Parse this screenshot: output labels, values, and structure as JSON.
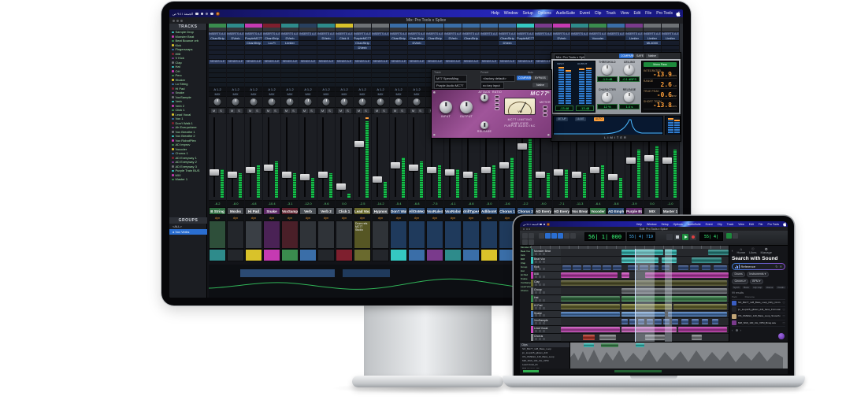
{
  "menu": {
    "items": [
      "Help",
      "Window",
      "Setup",
      "Options",
      "AudioSuite",
      "Event",
      "Clip",
      "Track",
      "View",
      "Edit",
      "File",
      "Pro Tools"
    ],
    "status_time": "الجمعة ٩:٤١ ص"
  },
  "monitor": {
    "window_title": "Mix: Pro Tools x Splice",
    "tracks_panel": {
      "title": "TRACKS",
      "dot_colors": [
        "#35c8c2",
        "#c53ab2",
        "#3a8c4e",
        "#d9c22a",
        "#3a6ea8",
        "#7e1f2e",
        "#7a3a8c",
        "#6e7276"
      ],
      "items": [
        "Sample Drop",
        "Monster Beat",
        "Beat Bounce vrb",
        "Kick",
        "Fingersnaps",
        "808",
        "V Kick",
        "Clap",
        "Hat",
        "OH",
        "Perc",
        "Shaker",
        "Lo String",
        "Hi Pad",
        "Snake",
        "VoxSample",
        "Verb",
        "Verb 2",
        "Click 1",
        "Lead Vocal",
        "Vox 1",
        "Don't Walk 1",
        "Ah Everywhere",
        "Vox Breathe 1",
        "Vox Breathe 2",
        "Vox RobotPlex",
        "AD Improv",
        "Vocoder",
        "Chorus 1",
        "AD Everyway 1",
        "AD Everyway 2",
        "AD Everyway 3",
        "Purple Train BUS",
        "MIX",
        "Master 1"
      ]
    },
    "groups_panel": {
      "title": "GROUPS",
      "items": [
        "<ALL>",
        "a Vox Verbs"
      ]
    },
    "mixer": {
      "inserts_label": "INSERTS A-E",
      "sends_label": "SENDS A-E",
      "io_in": "A 1-2",
      "io_out": "MIX",
      "auto_mode": "dyn",
      "color_band": [
        "#2e8b8b",
        "#23262b",
        "#d9c22a",
        "#c53ab2",
        "#3a8c4e",
        "#3a6ea8",
        "#23262b",
        "#7e1f2e",
        "#6a6a2e",
        "#23262b",
        "#35c8c2",
        "#3a6ea8",
        "#7a3a8c",
        "#2e8b8b",
        "#3a6ea8",
        "#d9c22a",
        "#3a6ea8",
        "#35c8c2",
        "#7a3a8c",
        "#c53ab2",
        "#3a8c4e",
        "#2e8b8b",
        "#3a6ea8",
        "#7a3a8c",
        "#44484e",
        "#44484e"
      ],
      "strips": [
        {
          "name": "B String",
          "cap": "#3a8c4e",
          "plate": "#2e6b40",
          "cmt": "#2e4f3a",
          "lvl": 0.35,
          "vol": "-6.2",
          "ins": [
            "ChanStrip"
          ]
        },
        {
          "name": "Mocks",
          "cap": "#2e8b8b",
          "plate": "#44484e",
          "cmt": "#23262b",
          "lvl": 0.3,
          "vol": "-8.0",
          "ins": [
            "DVerb"
          ]
        },
        {
          "name": "Hi Pad",
          "cap": "#c53ab2",
          "plate": "#5a5e64",
          "cmt": "#3a3f45",
          "lvl": 0.4,
          "vol": "-4.8",
          "ins": [
            "PurpleMC77",
            "ChanStrip"
          ]
        },
        {
          "name": "Snake",
          "cap": "#7e1f2e",
          "plate": "#5d2a66",
          "cmt": "#4a2255",
          "lvl": 0.45,
          "vol": "-10.4",
          "ins": [
            "ChanStrip",
            "Lo-Fi"
          ]
        },
        {
          "name": "VoxSample",
          "cap": "#2e8b8b",
          "plate": "#5d2430",
          "cmt": "#4a1f28",
          "lvl": 0.3,
          "vol": "-3.1",
          "ins": [
            "DVerb",
            "Limiter"
          ]
        },
        {
          "name": "Verb",
          "cap": "#28405e",
          "plate": "#4a4f55",
          "cmt": "#2f3338",
          "lvl": 0.25,
          "vol": "-12.0",
          "ins": []
        },
        {
          "name": "Verb 2",
          "cap": "#2e8b8b",
          "plate": "#4a4f55",
          "cmt": "#2f3338",
          "lvl": 0.3,
          "vol": "-9.6",
          "ins": [
            "DVerb"
          ]
        },
        {
          "name": "Click 1",
          "cap": "#d9c22a",
          "plate": "#4a4f55",
          "cmt": "#2f3338",
          "lvl": 0.05,
          "vol": "0.0",
          "ins": [
            "Click II"
          ]
        },
        {
          "name": "Lead Vocal",
          "cap": "#6e7276",
          "plate": "#6a6a2e",
          "cmt": "#565624",
          "lvl": 0.95,
          "vol": "-2.5",
          "ins": [
            "PurpleMC77",
            "ChanStrip",
            "DVerb"
          ],
          "note": "Drum refs MC77 Studio"
        },
        {
          "name": "Hypnos",
          "cap": "#6e7276",
          "plate": "#4a4f55",
          "cmt": "#2f3338",
          "lvl": 0.2,
          "vol": "-14.2",
          "ins": []
        },
        {
          "name": "Don't Walk!",
          "cap": "#3a6ea8",
          "plate": "#2b4a73",
          "cmt": "#1f3a5c",
          "lvl": 0.5,
          "vol": "-5.4",
          "ins": [
            "ChanStrip"
          ]
        },
        {
          "name": "AllOnMe2",
          "cap": "#3a6ea8",
          "plate": "#2b4a73",
          "cmt": "#1f3a5c",
          "lvl": 0.45,
          "vol": "-6.8",
          "ins": [
            "ChanStrip",
            "DVerb"
          ]
        },
        {
          "name": "VoxRule4",
          "cap": "#3a6ea8",
          "plate": "#2b4a73",
          "cmt": "#1f3a5c",
          "lvl": 0.4,
          "vol": "-7.5",
          "ins": [
            "ChanStrip"
          ]
        },
        {
          "name": "VoxRobot2",
          "cap": "#3a6ea8",
          "plate": "#2b4a73",
          "cmt": "#1f3a5c",
          "lvl": 0.35,
          "vol": "-4.1",
          "ins": [
            "DVerb"
          ]
        },
        {
          "name": "drillTypeAly",
          "cap": "#3a6ea8",
          "plate": "#2b4a73",
          "cmt": "#1f3a5c",
          "lvl": 0.3,
          "vol": "-8.8",
          "ins": [
            "ChanStrip"
          ]
        },
        {
          "name": "AdlibsnKme",
          "cap": "#3a6ea8",
          "plate": "#2b4a73",
          "cmt": "#1f3a5c",
          "lvl": 0.4,
          "vol": "-5.0",
          "ins": []
        },
        {
          "name": "Chorus 1",
          "cap": "#3a6ea8",
          "plate": "#2b4a73",
          "cmt": "#1f3a5c",
          "lvl": 0.5,
          "vol": "-3.6",
          "ins": [
            "ChanStrip",
            "DVerb"
          ]
        },
        {
          "name": "Chorus 2",
          "cap": "#35c8c2",
          "plate": "#2b4a73",
          "cmt": "#1f3a5c",
          "lvl": 0.9,
          "vol": "-2.2",
          "ins": [
            "PurpleMC77"
          ]
        },
        {
          "name": "AD Every 1",
          "cap": "#7a3a8c",
          "plate": "#4a4f55",
          "cmt": "#3a2a45",
          "lvl": 0.3,
          "vol": "-9.0",
          "ins": []
        },
        {
          "name": "AD Every 2",
          "cap": "#c53ab2",
          "plate": "#4a4f55",
          "cmt": "#3a2a45",
          "lvl": 0.35,
          "vol": "-7.1",
          "ins": [
            "DVerb"
          ]
        },
        {
          "name": "Vox Breathe",
          "cap": "#2e8b8b",
          "plate": "#44484e",
          "cmt": "#23262b",
          "lvl": 0.3,
          "vol": "-11.3",
          "ins": []
        },
        {
          "name": "Vocoder",
          "cap": "#3a8c4e",
          "plate": "#2e6b40",
          "cmt": "#2e4f3a",
          "lvl": 0.4,
          "vol": "-6.4",
          "ins": [
            "Vocoder"
          ]
        },
        {
          "name": "AD Emph 1",
          "cap": "#3a6ea8",
          "plate": "#2b4a73",
          "cmt": "#1f3a5c",
          "lvl": 0.25,
          "vol": "-5.8",
          "ins": []
        },
        {
          "name": "Purple BUS",
          "cap": "#7a3a8c",
          "plate": "#5d2a66",
          "cmt": "#4a2255",
          "lvl": 0.6,
          "vol": "-3.9",
          "ins": [
            "Limiter"
          ]
        },
        {
          "name": "MIX",
          "cap": "#6e7276",
          "plate": "#44484e",
          "cmt": "#2f3338",
          "lvl": 0.65,
          "vol": "0.0",
          "ins": [
            "Limiter",
            "ML4000"
          ]
        },
        {
          "name": "Master 1",
          "cap": "#6e7276",
          "plate": "#44484e",
          "cmt": "#2f3338",
          "lvl": 0.6,
          "vol": "-1.0",
          "ins": [
            "Limiter"
          ]
        }
      ]
    },
    "mc77": {
      "track_label": "Track",
      "preset_label": "Preset",
      "auto_label": "Auto",
      "track_name": "M77 SpecsMag",
      "plugin_name": "Purple Audio MC77",
      "preset_name": "<factory default>",
      "compare": "COMPARE",
      "bypass": "BYPASS",
      "native": "Native",
      "key_input": "no key input",
      "input_label": "INPUT",
      "output_label": "OUTPUT",
      "attack_label": "ATTACK",
      "release_label": "RELEASE",
      "ratio_label": "RATIO",
      "meter_label": "METER",
      "vu_label": "VU",
      "brand_line1": "MC77 LIMITING AMPLIFIER",
      "brand_line2": "PURPLE AUDIO INC",
      "logo": "MC77"
    },
    "limiter": {
      "title": "LIMITER",
      "compare": "COMPARE",
      "safe": "SAFE",
      "native": "Native",
      "preset": "Mono Pass",
      "brand": "weiss",
      "input_label": "INPUT",
      "output_label": "OUTPUT",
      "input_value": "-13.48",
      "output_value": "-13.48",
      "knobs": [
        {
          "label": "THRESHOLD",
          "value": "-1.5 dB"
        },
        {
          "label": "CEILING",
          "value": "-0.1 dBFS"
        },
        {
          "label": "CHARACTER",
          "value": "12 %"
        },
        {
          "label": "RELEASE",
          "value": "1.0 s"
        }
      ],
      "loudness": [
        {
          "label": "INTEGRATED",
          "value": "-13.9",
          "unit": "LUFS"
        },
        {
          "label": "RANGE",
          "value": "2.6",
          "unit": "LU"
        },
        {
          "label": "TRUE PEAK",
          "value": "-0.6",
          "unit": "dBTP"
        },
        {
          "label": "SHORT TERM",
          "value": "-13.8",
          "unit": "LUFS"
        }
      ],
      "graph_tabs": [
        "SETUP",
        "16-BIT",
        "AUTO"
      ]
    }
  },
  "laptop": {
    "window_title": "Edit: Pro Tools x Splice",
    "toolbar": {
      "main_counter": "56|  1|  000",
      "sub_counter": "55|  4|  719"
    },
    "rows": [
      {
        "name": "Monster Beat",
        "hdr": "#2e6e66",
        "clips": [
          [
            0.36,
            0.25,
            "#35c8c2"
          ],
          [
            0.62,
            0.07,
            "#35c8c2"
          ],
          [
            0.88,
            0.12,
            "#2a8f8a"
          ]
        ]
      },
      {
        "name": "Beat Vox",
        "hdr": "#35c8c2",
        "clips": [
          [
            0.36,
            0.22,
            "#49d8d2"
          ],
          [
            0.6,
            0.09,
            "#49d8d2"
          ],
          [
            0.78,
            0.18,
            "#2a8f8a"
          ]
        ]
      },
      {
        "name": "Kick",
        "hdr": "#3a5e9e",
        "clips": [
          [
            0.01,
            0.05,
            "#33508a"
          ],
          [
            0.07,
            0.05,
            "#33508a"
          ],
          [
            0.13,
            0.05,
            "#33508a"
          ],
          [
            0.19,
            0.05,
            "#33508a"
          ],
          [
            0.25,
            0.05,
            "#33508a"
          ],
          [
            0.31,
            0.05,
            "#33508a"
          ],
          [
            0.4,
            0.06,
            "#33508a"
          ],
          [
            0.47,
            0.05,
            "#33508a"
          ],
          [
            0.53,
            0.05,
            "#33508a"
          ],
          [
            0.6,
            0.05,
            "#33508a"
          ],
          [
            0.7,
            0.06,
            "#33508a"
          ],
          [
            0.77,
            0.05,
            "#33508a"
          ],
          [
            0.84,
            0.05,
            "#33508a"
          ],
          [
            0.91,
            0.08,
            "#33508a"
          ]
        ]
      },
      {
        "name": "808",
        "hdr": "#c53ab2",
        "clips": [
          [
            0.0,
            0.34,
            "#c53ab2"
          ],
          [
            0.36,
            0.05,
            "#e357d0"
          ],
          [
            0.5,
            0.5,
            "#c53ab2"
          ]
        ]
      },
      {
        "name": "Clap",
        "hdr": "#6a6a2e",
        "clips": [
          [
            0.0,
            0.99,
            "#56562a"
          ]
        ]
      },
      {
        "name": "Group",
        "hdr": "#6e7276",
        "clips": [
          [
            0.36,
            0.63,
            "#70747a"
          ]
        ]
      },
      {
        "name": "Hat",
        "hdr": "#3a8c4e",
        "clips": [
          [
            0.0,
            0.35,
            "#2f6b3e"
          ],
          [
            0.36,
            0.63,
            "#3f8c50"
          ]
        ]
      },
      {
        "name": "Hi Pad",
        "hdr": "#8a8a3a",
        "clips": [
          [
            0.0,
            0.35,
            "#6a6a2e"
          ],
          [
            0.36,
            0.3,
            "#8a8a3a"
          ],
          [
            0.67,
            0.32,
            "#6a6a2e"
          ]
        ]
      },
      {
        "name": "Snake",
        "hdr": "#4a7ec2",
        "clips": [
          [
            0.0,
            0.35,
            "#4a7ec2"
          ],
          [
            0.36,
            0.26,
            "#6aa0e0"
          ],
          [
            0.64,
            0.35,
            "#4a7ec2"
          ]
        ]
      },
      {
        "name": "VoxSample",
        "hdr": "#3a6ea8",
        "clips": [
          [
            0.36,
            0.04,
            "#4a6eb0"
          ],
          [
            0.41,
            0.04,
            "#4a6eb0"
          ],
          [
            0.46,
            0.04,
            "#4a6eb0"
          ],
          [
            0.51,
            0.04,
            "#4a6eb0"
          ],
          [
            0.56,
            0.04,
            "#4a6eb0"
          ],
          [
            0.61,
            0.04,
            "#4a6eb0"
          ],
          [
            0.66,
            0.04,
            "#4a6eb0"
          ],
          [
            0.72,
            0.04,
            "#4a6eb0"
          ],
          [
            0.78,
            0.04,
            "#4a6eb0"
          ],
          [
            0.84,
            0.04,
            "#4a6eb0"
          ],
          [
            0.9,
            0.04,
            "#4a6eb0"
          ]
        ]
      },
      {
        "name": "Lead Vocal",
        "hdr": "#d04ac0",
        "clips": [
          [
            0.0,
            0.35,
            "#d04ac0"
          ],
          [
            0.36,
            0.33,
            "#e06ad0"
          ],
          [
            0.7,
            0.29,
            "#c53ab2"
          ]
        ]
      },
      {
        "name": "Chorus",
        "hdr": "#8a8d90",
        "clips": [
          [
            0.13,
            0.07,
            "#c0392b"
          ],
          [
            0.23,
            0.1,
            "#8a8d90"
          ],
          [
            0.5,
            0.12,
            "#8a8d90"
          ],
          [
            0.78,
            0.06,
            "#8a8d90"
          ]
        ]
      }
    ],
    "splice": {
      "nav": [
        {
          "icon": "‹",
          "label": ""
        },
        {
          "icon": "⌂",
          "label": "Home"
        },
        {
          "icon": "♡",
          "label": "Likes"
        },
        {
          "icon": "⚙",
          "label": "Manage"
        }
      ],
      "heading": "Search with Sound",
      "search_value": "Reference",
      "chips": [
        "Drums",
        "Instruments ▾",
        "Genres ▾",
        "BPM ▾"
      ],
      "tags": [
        "Synth",
        "Bass",
        "Hip Hop",
        "House",
        "Vocals",
        "+"
      ],
      "results_label": "99 results",
      "col_pack": "Pack",
      "col_filename": "Filename",
      "results": [
        {
          "thumb": "#3a5ec2",
          "name": "SO_BH77_128_Bass_Loop_Dirty_Cmin.wav"
        },
        {
          "thumb": "#23252a",
          "name": "jm_loop125_glisten_drill_bass_Fmin.wav"
        },
        {
          "thumb": "#c2a678",
          "name": "OS_OMEGA_140_Bass_Loop_Smooth.wav"
        },
        {
          "thumb": "#7a3a8c",
          "name": "MM_Shift_130_CH_VPM_Bmaj.wav"
        }
      ]
    },
    "bottom": {
      "browser_title": "Clips",
      "items": [
        "SO_BH77_128_Bass_Loop",
        "jm_loop125_glisten_drill",
        "OS_OMEGA_140_Bass_Loop",
        "MM_Shift_130_CH_VPM",
        "Lead Vocal_01",
        "808_bounce_04"
      ]
    }
  }
}
